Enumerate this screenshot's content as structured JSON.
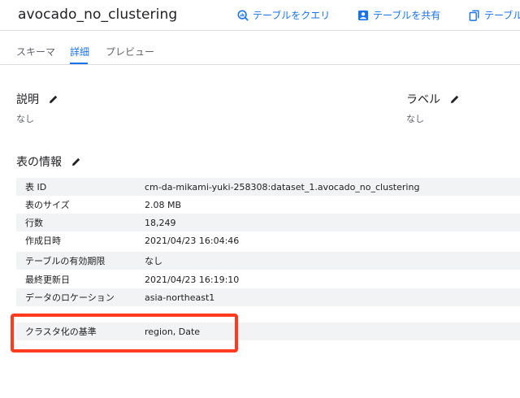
{
  "header": {
    "title": "avocado_no_clustering",
    "actions": [
      {
        "label": "テーブルをクエリ",
        "icon": "query-icon"
      },
      {
        "label": "テーブルを共有",
        "icon": "share-person-icon"
      },
      {
        "label": "テーブル",
        "icon": "copy-icon"
      }
    ]
  },
  "tabs": [
    {
      "label": "スキーマ",
      "active": false
    },
    {
      "label": "詳細",
      "active": true
    },
    {
      "label": "プレビュー",
      "active": false
    }
  ],
  "description": {
    "heading": "説明",
    "value": "なし",
    "icon": "edit-pencil-icon"
  },
  "labels": {
    "heading": "ラベル",
    "value": "なし",
    "icon": "edit-pencil-icon"
  },
  "table_info": {
    "heading": "表の情報",
    "icon": "edit-pencil-icon",
    "rows": [
      {
        "key": "表 ID",
        "value": "cm-da-mikami-yuki-258308:dataset_1.avocado_no_clustering"
      },
      {
        "key": "表のサイズ",
        "value": "2.08 MB"
      },
      {
        "key": "行数",
        "value": "18,249"
      },
      {
        "key": "作成日時",
        "value": "2021/04/23 16:04:46"
      },
      {
        "key": "テーブルの有効期限",
        "value": "なし"
      },
      {
        "key": "最終更新日",
        "value": "2021/04/23 16:19:10"
      },
      {
        "key": "データのロケーション",
        "value": "asia-northeast1"
      },
      {
        "key": "クラスタ化の基準",
        "value": "region, Date"
      }
    ]
  },
  "colors": {
    "accent": "#1a73e8",
    "highlight": "#ff3b1f",
    "row_alt": "#f1f3f4"
  }
}
